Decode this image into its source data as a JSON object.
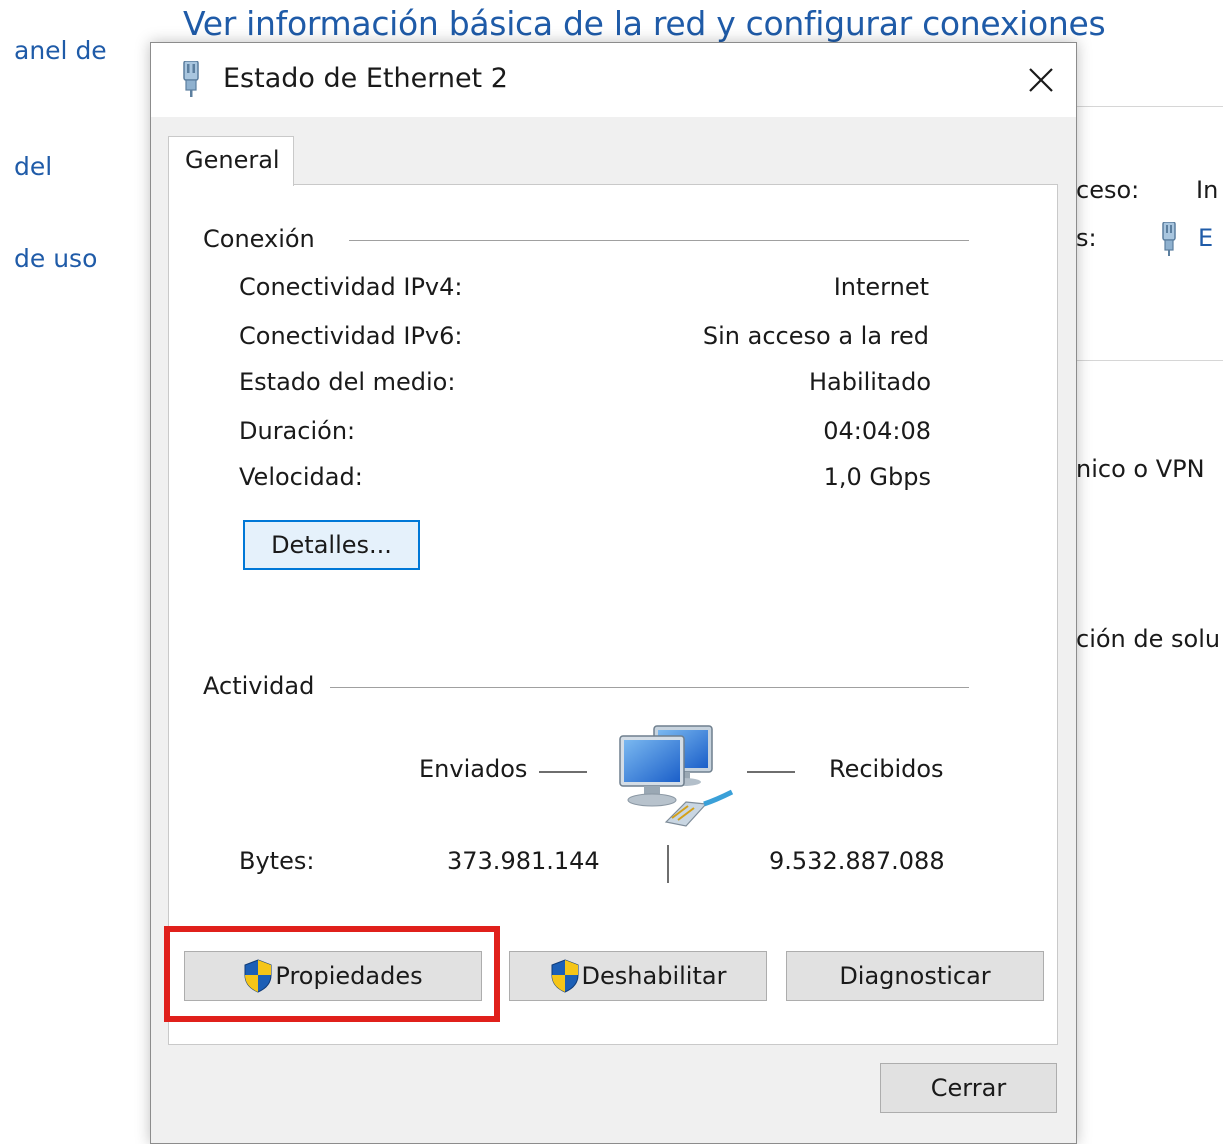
{
  "background": {
    "page_title": "Ver información básica de la red y configurar conexiones",
    "left_links": [
      "anel de",
      "del",
      "de uso"
    ],
    "right_labels": {
      "access_label": "ceso:",
      "access_value": "In",
      "connections_label": "s:",
      "connections_value": "E",
      "vpn_text": "nico o VPN",
      "troubleshoot_text": "ción de solu"
    }
  },
  "dialog": {
    "title": "Estado de Ethernet 2",
    "tab": "General",
    "connection": {
      "section_label": "Conexión",
      "rows": [
        {
          "label": "Conectividad IPv4:",
          "value": "Internet"
        },
        {
          "label": "Conectividad IPv6:",
          "value": "Sin acceso a la red"
        },
        {
          "label": "Estado del medio:",
          "value": "Habilitado"
        },
        {
          "label": "Duración:",
          "value": "04:04:08"
        },
        {
          "label": "Velocidad:",
          "value": "1,0 Gbps"
        }
      ],
      "details_button": "Detalles..."
    },
    "activity": {
      "section_label": "Actividad",
      "sent_label": "Enviados",
      "received_label": "Recibidos",
      "bytes_label": "Bytes:",
      "bytes_sent": "373.981.144",
      "bytes_received": "9.532.887.088"
    },
    "buttons": {
      "properties": "Propiedades",
      "disable": "Deshabilitar",
      "diagnose": "Diagnosticar",
      "close": "Cerrar"
    }
  },
  "colors": {
    "link_blue": "#1f5ba8",
    "focus_blue": "#0078d7",
    "highlight_red": "#e0201b"
  }
}
